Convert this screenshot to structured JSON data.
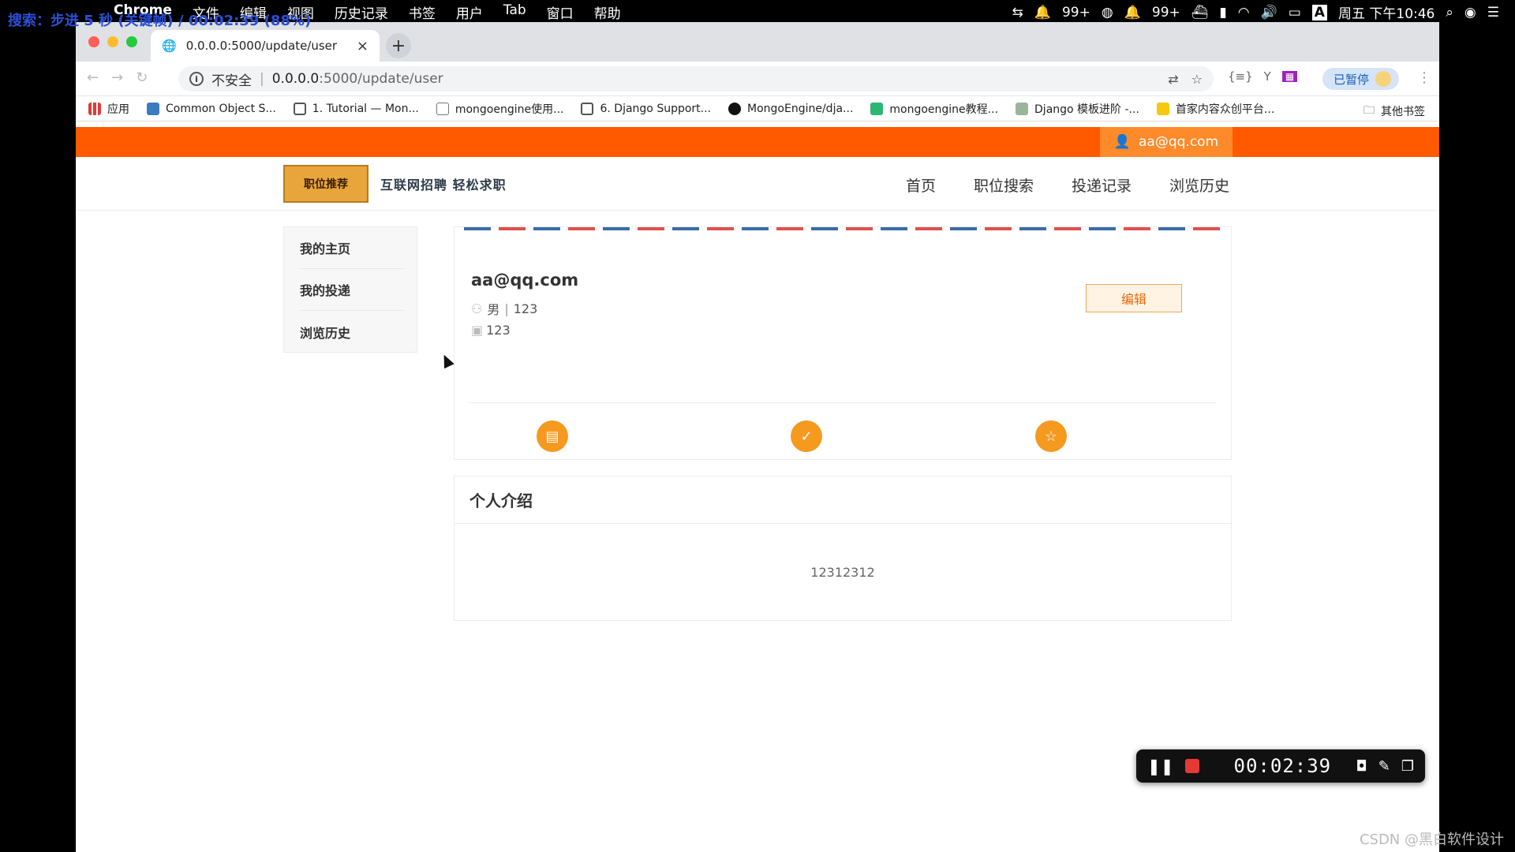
{
  "overlay": {
    "text": "搜索：步进 5 秒 (关键帧) / 00:02:39 (88%)"
  },
  "menubar": {
    "app_name": "Chrome",
    "items": [
      "文件",
      "编辑",
      "视图",
      "历史记录",
      "书签",
      "用户",
      "Tab",
      "窗口",
      "帮助"
    ],
    "status": {
      "qq1": "99+",
      "qq2": "99+",
      "datetime": "周五 下午10:46",
      "ime": "A"
    }
  },
  "browser": {
    "tab_title": "0.0.0.0:5000/update/user",
    "new_tab": "+",
    "close": "×",
    "address": {
      "insecure_label": "不安全",
      "host": "0.0.0.0",
      "path": ":5000/update/user"
    },
    "paused_label": "已暂停",
    "bookmarks": [
      {
        "label": "应用",
        "color": "#e53935"
      },
      {
        "label": "Common Object S...",
        "color": "#3b7bbf"
      },
      {
        "label": "1. Tutorial — Mon...",
        "color": "#555555"
      },
      {
        "label": "mongoengine使用...",
        "color": "#777777"
      },
      {
        "label": "6. Django Support...",
        "color": "#555555"
      },
      {
        "label": "MongoEngine/dja...",
        "color": "#111111"
      },
      {
        "label": "mongoengine教程...",
        "color": "#2bb673"
      },
      {
        "label": "Django 模板进阶 -...",
        "color": "#7a9a7a"
      },
      {
        "label": "首家内容众创平台...",
        "color": "#f6c90e"
      }
    ],
    "other_bookmarks": "其他书签"
  },
  "site": {
    "user_email": "aa@qq.com",
    "logo_text": "职位推荐",
    "slogan": "互联网招聘 轻松求职",
    "nav": [
      "首页",
      "职位搜索",
      "投递记录",
      "浏览历史"
    ],
    "sidebar": [
      "我的主页",
      "我的投递",
      "浏览历史"
    ],
    "profile": {
      "name": "aa@qq.com",
      "gender": "男",
      "age": "123",
      "extra": "123",
      "edit_label": "编辑"
    },
    "intro": {
      "title": "个人介绍",
      "body": "12312312"
    }
  },
  "recorder": {
    "time": "00:02:39"
  },
  "watermark": "CSDN @黑白软件设计"
}
